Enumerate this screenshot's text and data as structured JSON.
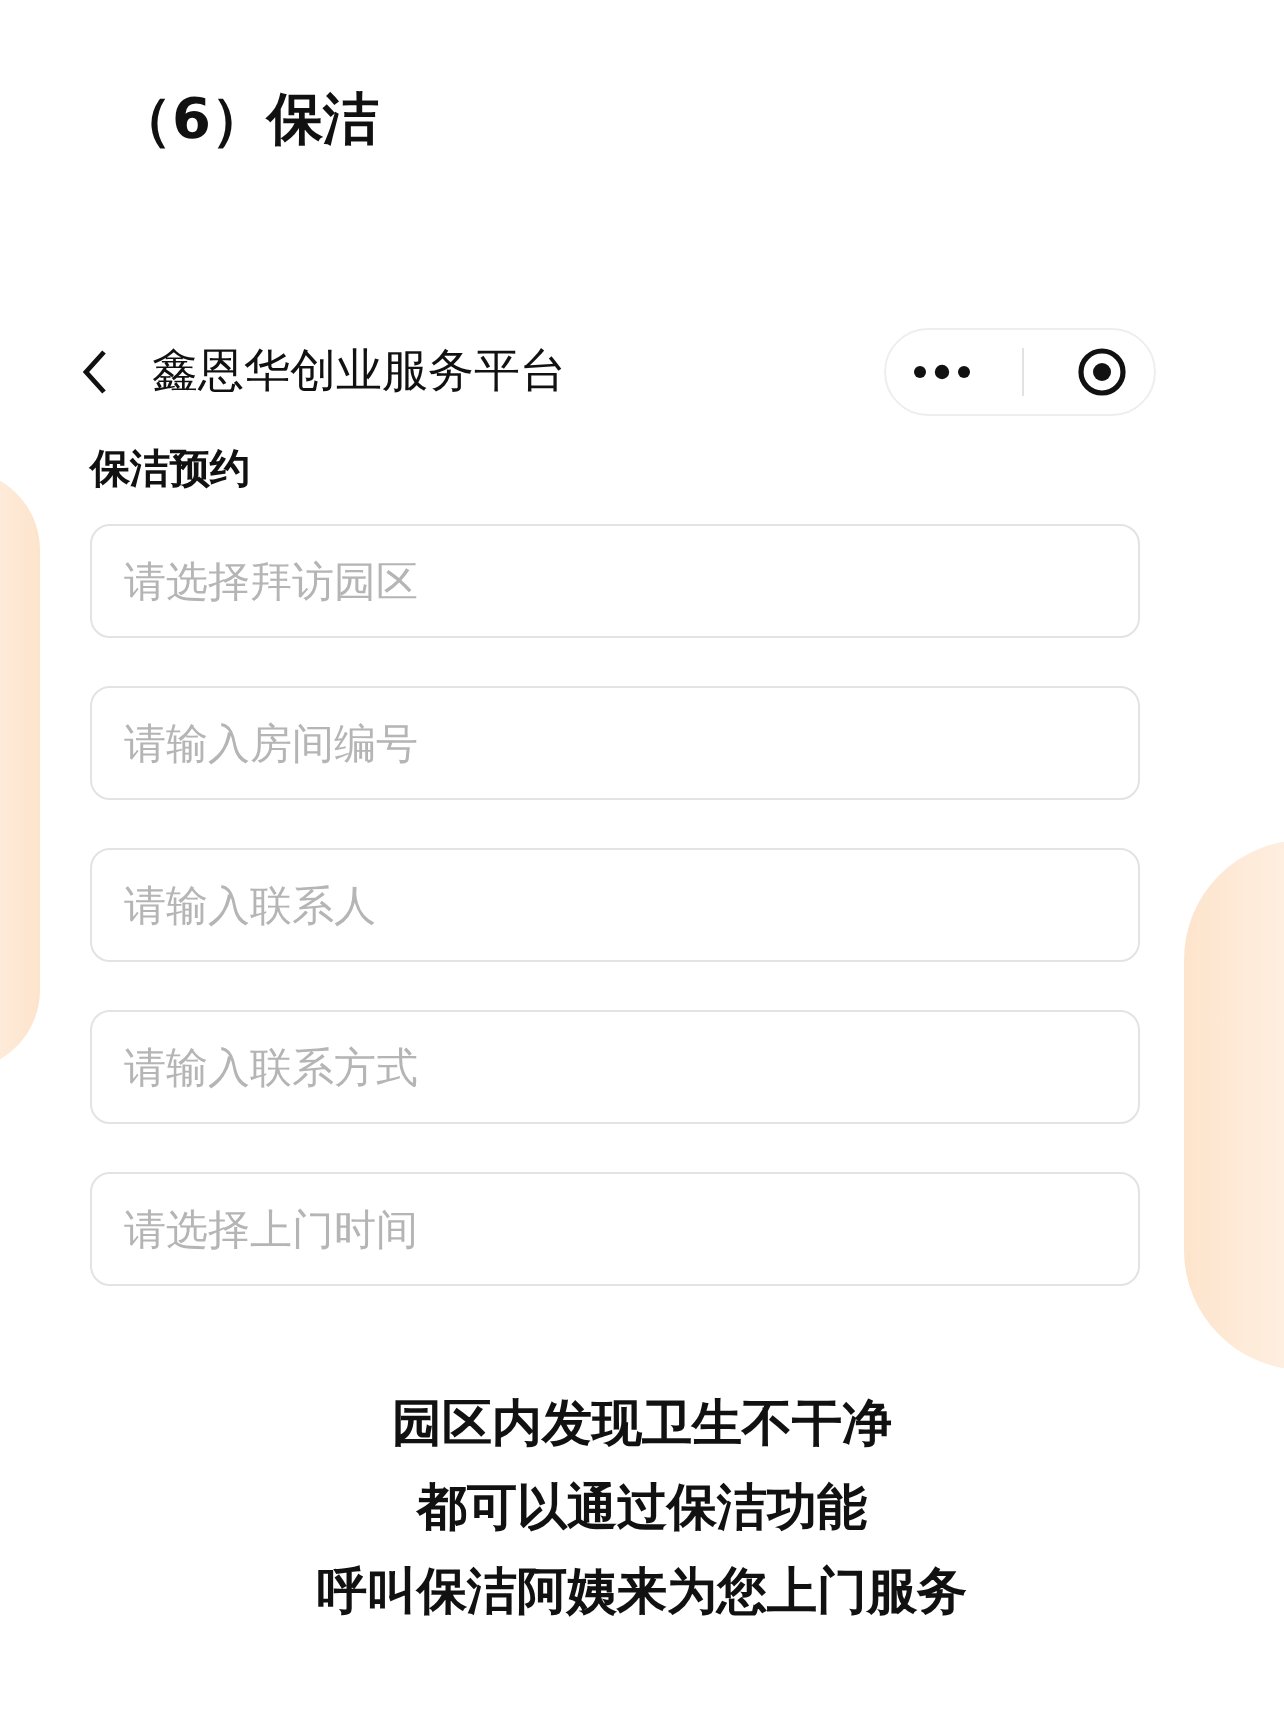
{
  "page_title": "（6）保洁",
  "nav_bar": {
    "title": "鑫恩华创业服务平台"
  },
  "section_title": "保洁预约",
  "fields": [
    {
      "placeholder": "请选择拜访园区"
    },
    {
      "placeholder": "请输入房间编号"
    },
    {
      "placeholder": "请输入联系人"
    },
    {
      "placeholder": "请输入联系方式"
    },
    {
      "placeholder": "请选择上门时间"
    }
  ],
  "caption": [
    "园区内发现卫生不干净",
    "都可以通过保洁功能",
    "呼叫保洁阿姨来为您上门服务"
  ]
}
